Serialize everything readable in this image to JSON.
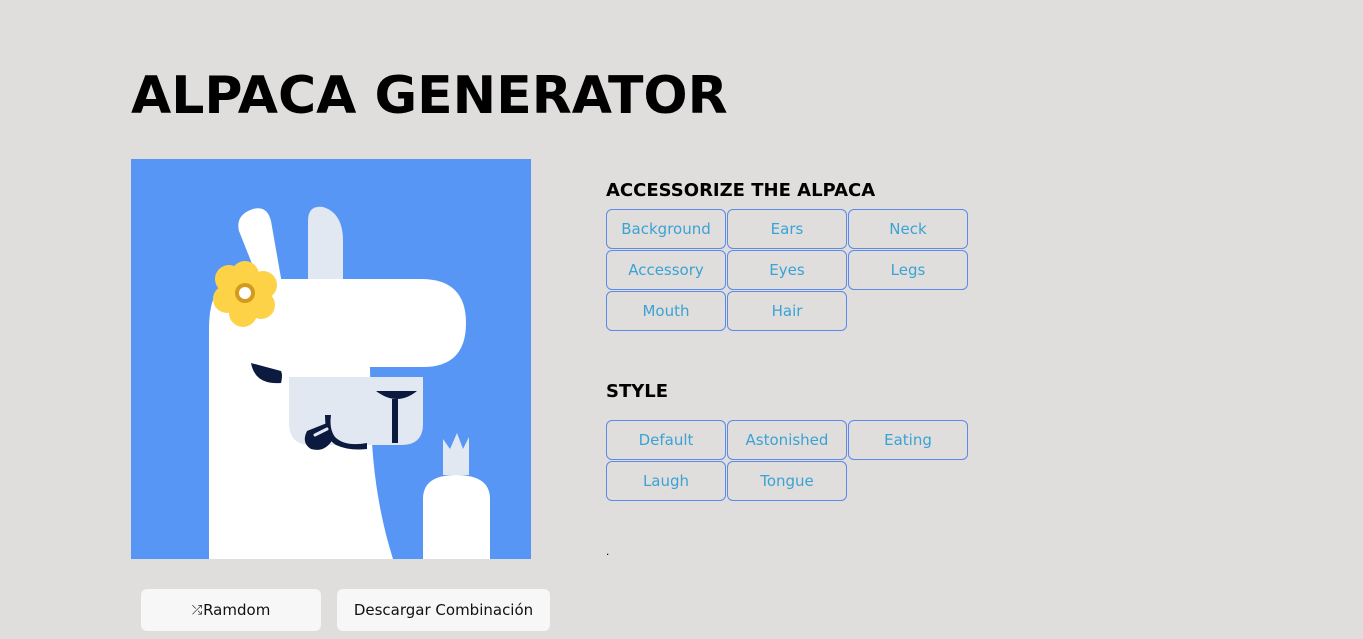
{
  "title": "ALPACA GENERATOR",
  "colors": {
    "page_background": "#e0dddd",
    "alpaca_background": "#5896f5",
    "button_border": "#5b8be6",
    "button_text": "#3aa3d4"
  },
  "accessorize": {
    "heading": "ACCESSORIZE THE ALPACA",
    "buttons": [
      "Background",
      "Ears",
      "Neck",
      "Accessory",
      "Eyes",
      "Legs",
      "Mouth",
      "Hair"
    ]
  },
  "style": {
    "heading": "STYLE",
    "buttons": [
      "Default",
      "Astonished",
      "Eating",
      "Laugh",
      "Tongue"
    ]
  },
  "status_text": ".",
  "actions": {
    "random_icon": "shuffle-icon",
    "random_label": "Ramdom",
    "download_label": "Descargar Combinación"
  }
}
